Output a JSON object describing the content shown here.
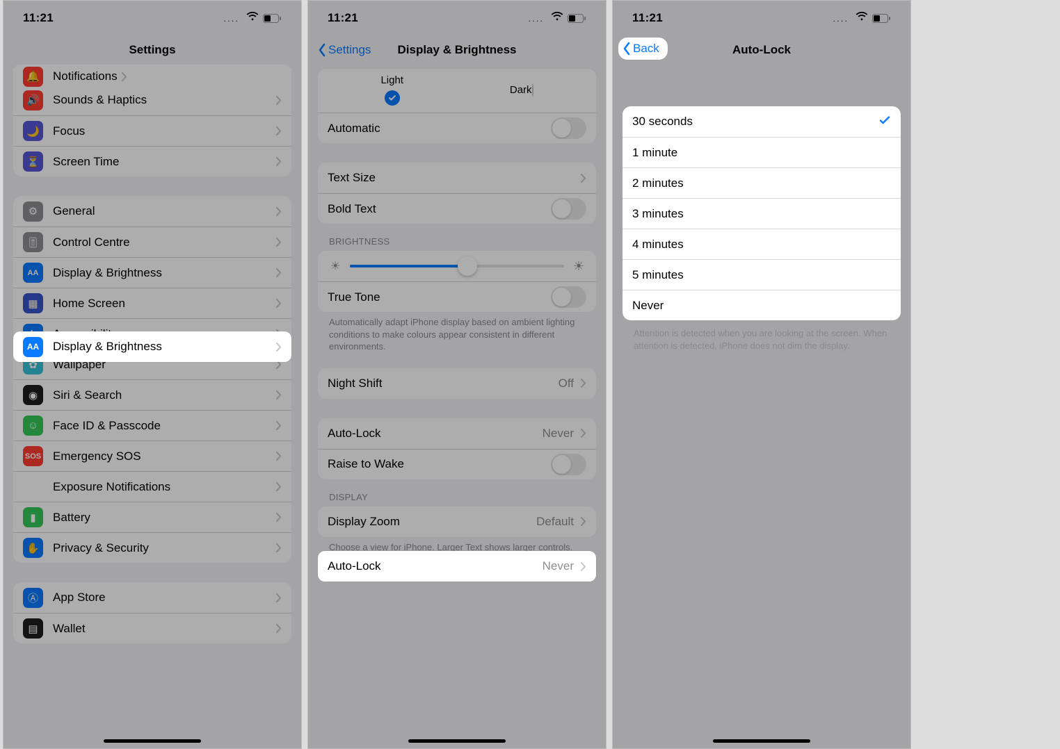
{
  "status": {
    "time": "11:21"
  },
  "panel1": {
    "nav_title": "Settings",
    "top_partial": "Notifications",
    "group_a": [
      {
        "label": "Sounds & Haptics",
        "color": "#ff3b30",
        "icon": "speaker"
      },
      {
        "label": "Focus",
        "color": "#5856d6",
        "icon": "moon"
      },
      {
        "label": "Screen Time",
        "color": "#5856d6",
        "icon": "hourglass"
      }
    ],
    "group_b": [
      {
        "label": "General",
        "color": "#8e8e93",
        "icon": "gear"
      },
      {
        "label": "Control Centre",
        "color": "#8e8e93",
        "icon": "switches"
      },
      {
        "label": "Display & Brightness",
        "color": "#0a7aff",
        "icon": "aa",
        "highlight": true
      },
      {
        "label": "Home Screen",
        "color": "#3955c9",
        "icon": "grid"
      },
      {
        "label": "Accessibility",
        "color": "#0a7aff",
        "icon": "person"
      },
      {
        "label": "Wallpaper",
        "color": "#34c1d9",
        "icon": "flower"
      },
      {
        "label": "Siri & Search",
        "color": "#1c1c1e",
        "icon": "siri"
      },
      {
        "label": "Face ID & Passcode",
        "color": "#34c759",
        "icon": "face"
      },
      {
        "label": "Emergency SOS",
        "color": "#ff3b30",
        "icon": "sos"
      },
      {
        "label": "Exposure Notifications",
        "color": "#ffffff",
        "icon": "exposure"
      },
      {
        "label": "Battery",
        "color": "#34c759",
        "icon": "battery"
      },
      {
        "label": "Privacy & Security",
        "color": "#0a7aff",
        "icon": "hand"
      }
    ],
    "group_c": [
      {
        "label": "App Store",
        "color": "#0a7aff",
        "icon": "appstore"
      },
      {
        "label": "Wallet",
        "color": "#1c1c1e",
        "icon": "wallet"
      }
    ]
  },
  "panel2": {
    "back_label": "Settings",
    "nav_title": "Display & Brightness",
    "appearance": {
      "light": "Light",
      "dark": "Dark"
    },
    "automatic_label": "Automatic",
    "text_size_label": "Text Size",
    "bold_text_label": "Bold Text",
    "brightness_header": "BRIGHTNESS",
    "true_tone_label": "True Tone",
    "true_tone_footer": "Automatically adapt iPhone display based on ambient lighting conditions to make colours appear consistent in different environments.",
    "night_shift_label": "Night Shift",
    "night_shift_value": "Off",
    "auto_lock_label": "Auto-Lock",
    "auto_lock_value": "Never",
    "raise_to_wake_label": "Raise to Wake",
    "display_header": "DISPLAY",
    "display_zoom_label": "Display Zoom",
    "display_zoom_value": "Default",
    "display_zoom_footer": "Choose a view for iPhone. Larger Text shows larger controls. Default shows more content."
  },
  "panel3": {
    "back_label": "Back",
    "nav_title": "Auto-Lock",
    "options": [
      "30 seconds",
      "1 minute",
      "2 minutes",
      "3 minutes",
      "4 minutes",
      "5 minutes",
      "Never"
    ],
    "selected_index": 0,
    "footer": "Attention is detected when you are looking at the screen. When attention is detected, iPhone does not dim the display."
  }
}
